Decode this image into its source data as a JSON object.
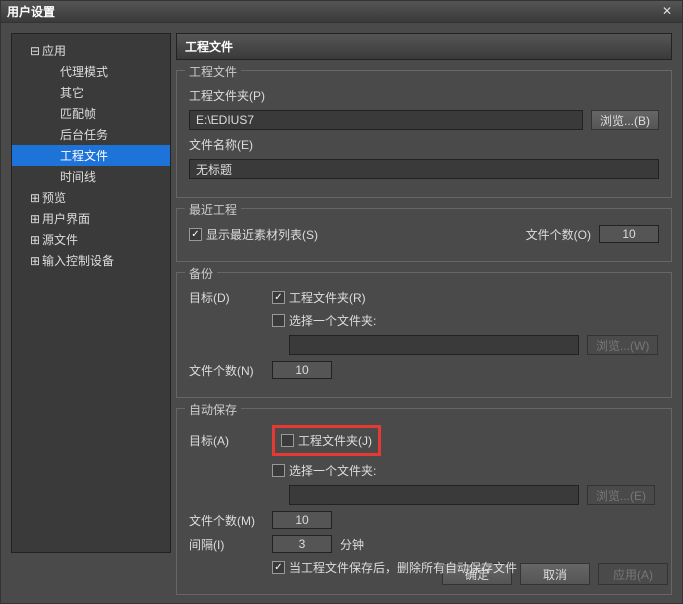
{
  "window": {
    "title": "用户设置",
    "close": "✕"
  },
  "sidebar": {
    "app": "应用",
    "children": [
      "代理模式",
      "其它",
      "匹配帧",
      "后台任务",
      "工程文件",
      "时间线"
    ],
    "others": [
      "预览",
      "用户界面",
      "源文件",
      "输入控制设备"
    ]
  },
  "page": {
    "header": "工程文件"
  },
  "project": {
    "group": "工程文件",
    "folder_label": "工程文件夹(P)",
    "folder_value": "E:\\EDIUS7",
    "browse": "浏览...(B)",
    "name_label": "文件名称(E)",
    "name_value": "无标题"
  },
  "recent": {
    "group": "最近工程",
    "show_list": "显示最近素材列表(S)",
    "count_label": "文件个数(O)",
    "count_value": "10"
  },
  "backup": {
    "group": "备份",
    "target_label": "目标(D)",
    "project_folder": "工程文件夹(R)",
    "select_folder": "选择一个文件夹:",
    "browse": "浏览...(W)",
    "count_label": "文件个数(N)",
    "count_value": "10"
  },
  "autosave": {
    "group": "自动保存",
    "target_label": "目标(A)",
    "project_folder": "工程文件夹(J)",
    "select_folder": "选择一个文件夹:",
    "browse": "浏览...(E)",
    "count_label": "文件个数(M)",
    "count_value": "10",
    "interval_label": "间隔(I)",
    "interval_value": "3",
    "interval_unit": "分钟",
    "delete_after": "当工程文件保存后，删除所有自动保存文件"
  },
  "footer": {
    "ok": "确定",
    "cancel": "取消",
    "apply": "应用(A)"
  }
}
